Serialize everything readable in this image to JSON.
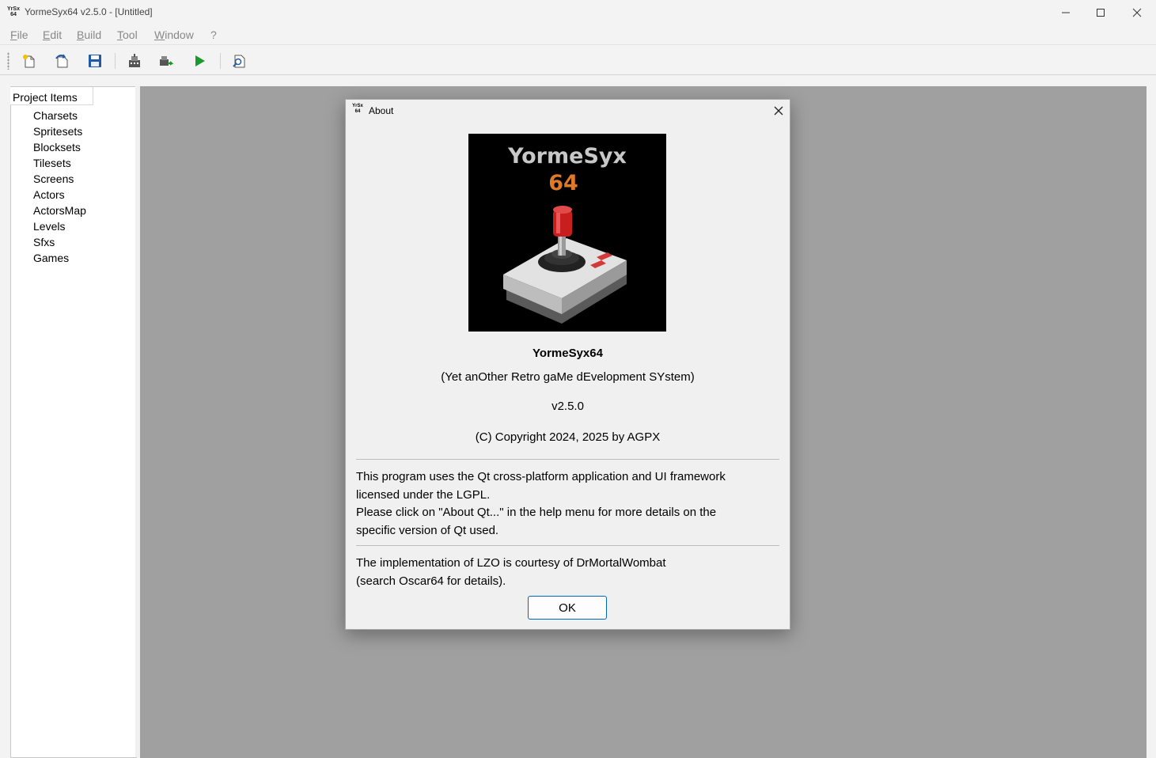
{
  "window": {
    "title": "YormeSyx64 v2.5.0 - [Untitled]",
    "icon_text_top": "YrSx",
    "icon_text_bottom": "64"
  },
  "menu": [
    {
      "key": "F",
      "rest": "ile"
    },
    {
      "key": "E",
      "rest": "dit"
    },
    {
      "key": "B",
      "rest": "uild"
    },
    {
      "key": "T",
      "rest": "ool"
    },
    {
      "key": "W",
      "rest": "indow"
    },
    {
      "key": "",
      "rest": "?"
    }
  ],
  "toolbar": {
    "icons": [
      "new-project-icon",
      "open-project-icon",
      "save-icon",
      "build-icon",
      "build-export-icon",
      "run-icon",
      "preview-icon"
    ]
  },
  "project_tree": {
    "header": "Project Items",
    "items": [
      "Charsets",
      "Spritesets",
      "Blocksets",
      "Tilesets",
      "Screens",
      "Actors",
      "ActorsMap",
      "Levels",
      "Sfxs",
      "Games"
    ]
  },
  "about_dialog": {
    "title": "About",
    "logo_text_top": "YormeSyx",
    "logo_text_bottom": "64",
    "app_name": "YormeSyx64",
    "subtitle": "(Yet anOther Retro gaMe dEvelopment SYstem)",
    "version": "v2.5.0",
    "copyright": "(C) Copyright 2024, 2025 by AGPX",
    "qt_line1": "This program uses the Qt cross-platform application and UI framework",
    "qt_line2": "licensed under the LGPL.",
    "qt_line3": "Please click on \"About Qt...\" in the help menu for more details on the",
    "qt_line4": "specific version of Qt used.",
    "lzo_line1": "The implementation of LZO is courtesy of DrMortalWombat",
    "lzo_line2": "(search Oscar64 for details).",
    "ok_label": "OK"
  },
  "colors": {
    "logo_orange": "#e07a28",
    "logo_gray": "#c8c8c8",
    "joystick_red": "#c81e1e",
    "run_green": "#1a9a2a",
    "save_blue": "#1f5aa8"
  }
}
